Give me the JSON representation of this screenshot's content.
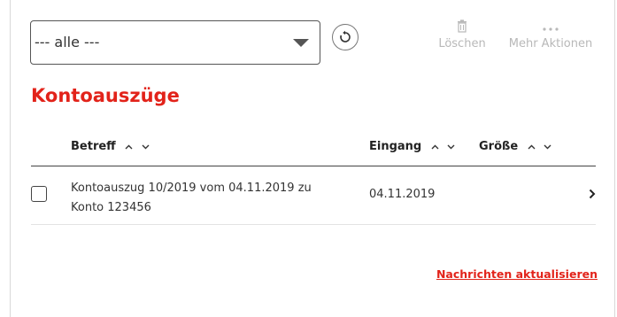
{
  "filter": {
    "selected": "--- alle ---"
  },
  "toolbar": {
    "refresh_icon": "refresh-icon",
    "delete_label": "Löschen",
    "delete_icon": "trash-icon",
    "more_label": "Mehr Aktionen",
    "more_icon": "ellipsis-icon"
  },
  "section": {
    "title": "Kontoauszüge"
  },
  "table": {
    "columns": [
      {
        "label": "Betreff",
        "sort_up": "^",
        "sort_down": "v"
      },
      {
        "label": "Eingang",
        "sort_up": "^",
        "sort_down": "v"
      },
      {
        "label": "Größe",
        "sort_up": "^",
        "sort_down": "v"
      }
    ],
    "rows": [
      {
        "subject_line1": "Kontoauszug 10/2019 vom 04.11.2019 zu",
        "subject_line2": "Konto 123456",
        "date": "04.11.2019",
        "size": "",
        "checked": false
      }
    ]
  },
  "footer": {
    "refresh_link": "Nachrichten aktualisieren"
  },
  "colors": {
    "accent": "#e2231a",
    "disabled": "#b8b8b8",
    "border": "#444444"
  }
}
